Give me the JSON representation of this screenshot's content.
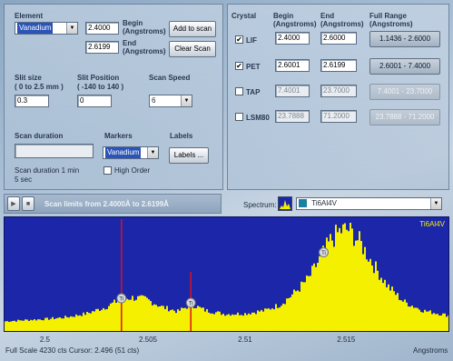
{
  "element": {
    "label": "Element",
    "selected": "Vanadium",
    "begin_value": "2.4000",
    "begin_label": "Begin",
    "begin_unit": "(Angstroms)",
    "end_value": "2.6199",
    "end_label": "End",
    "end_unit": "(Angstroms)",
    "add_button": "Add to scan",
    "clear_button": "Clear Scan"
  },
  "slit": {
    "size_label": "Slit size",
    "size_range": "( 0 to 2.5 mm )",
    "size_value": "0.3",
    "position_label": "Slit Position",
    "position_range": "( -140 to 140 )",
    "position_value": "0",
    "speed_label": "Scan Speed",
    "speed_value": "6"
  },
  "scan": {
    "duration_label": "Scan duration",
    "duration_text_1": "Scan duration 1 min",
    "duration_text_2": "5 sec",
    "markers_label": "Markers",
    "markers_value": "Vanadium",
    "high_order_label": "High Order",
    "labels_label": "Labels",
    "labels_button": "Labels ..."
  },
  "crystal_table": {
    "headers": {
      "crystal": "Crystal",
      "begin": "Begin",
      "begin_unit": "(Angstroms)",
      "end": "End",
      "end_unit": "(Angstroms)",
      "full_range": "Full Range",
      "full_range_unit": "(Angstroms)"
    },
    "rows": [
      {
        "name": "LIF",
        "checked": "✔",
        "begin": "2.4000",
        "end": "2.6000",
        "range": "1.1436 - 2.6000"
      },
      {
        "name": "PET",
        "checked": "✔",
        "begin": "2.6001",
        "end": "2.6199",
        "range": "2.6001 - 7.4000"
      },
      {
        "name": "TAP",
        "checked": "",
        "begin": "7.4001",
        "end": "23.7000",
        "range": "7.4001 - 23.7000"
      },
      {
        "name": "LSM80",
        "checked": "",
        "begin": "23.7888",
        "end": "71.2000",
        "range": "23.7888 - 71.2000"
      }
    ]
  },
  "status": {
    "scan_limits": "Scan limits from 2.4000Å to 2.6199Å",
    "spectrum_label": "Spectrum:",
    "spectrum_value": "Ti6Al4V"
  },
  "chart_data": {
    "type": "area",
    "series_label": "Ti6Al4V",
    "x_ticks": [
      "2.5",
      "2.505",
      "2.51",
      "2.515"
    ],
    "x_tick_values": [
      2.5,
      2.505,
      2.51,
      2.515
    ],
    "xlim": [
      2.4979,
      2.5203
    ],
    "ylim": [
      0,
      4230
    ],
    "xlabel": "Angstroms",
    "marker_labels": [
      "Ti",
      "Ti",
      "Ti"
    ],
    "markers": [
      {
        "x": 2.5038,
        "label": "Ti"
      },
      {
        "x": 2.5073,
        "label": "Ti"
      },
      {
        "x": 2.514,
        "label": "Ti"
      }
    ],
    "red_lines": [
      2.5038,
      2.5073
    ],
    "x": [
      2.4979,
      2.499,
      2.5,
      2.501,
      2.502,
      2.503,
      2.5036,
      2.5042,
      2.505,
      2.5058,
      2.5066,
      2.5073,
      2.508,
      2.509,
      2.51,
      2.511,
      2.5118,
      2.5125,
      2.5132,
      2.5138,
      2.5143,
      2.5148,
      2.5152,
      2.5158,
      2.5165,
      2.5172,
      2.518,
      2.519,
      2.5203
    ],
    "y": [
      340,
      390,
      430,
      500,
      640,
      900,
      1150,
      1260,
      1200,
      900,
      720,
      1000,
      760,
      620,
      640,
      760,
      1000,
      1450,
      2000,
      2800,
      3450,
      3850,
      3900,
      3400,
      2500,
      1700,
      1100,
      750,
      560
    ],
    "footer": "Full Scale 4230 cts Cursor: 2.496  (51 cts)"
  },
  "colors": {
    "plot_bg": "#1b26a8",
    "fill": "#f4f000",
    "marker_line": "#e0101a"
  },
  "icons": {
    "play": "play-icon",
    "stop": "stop-icon",
    "spectrum": "spectrum-icon"
  }
}
